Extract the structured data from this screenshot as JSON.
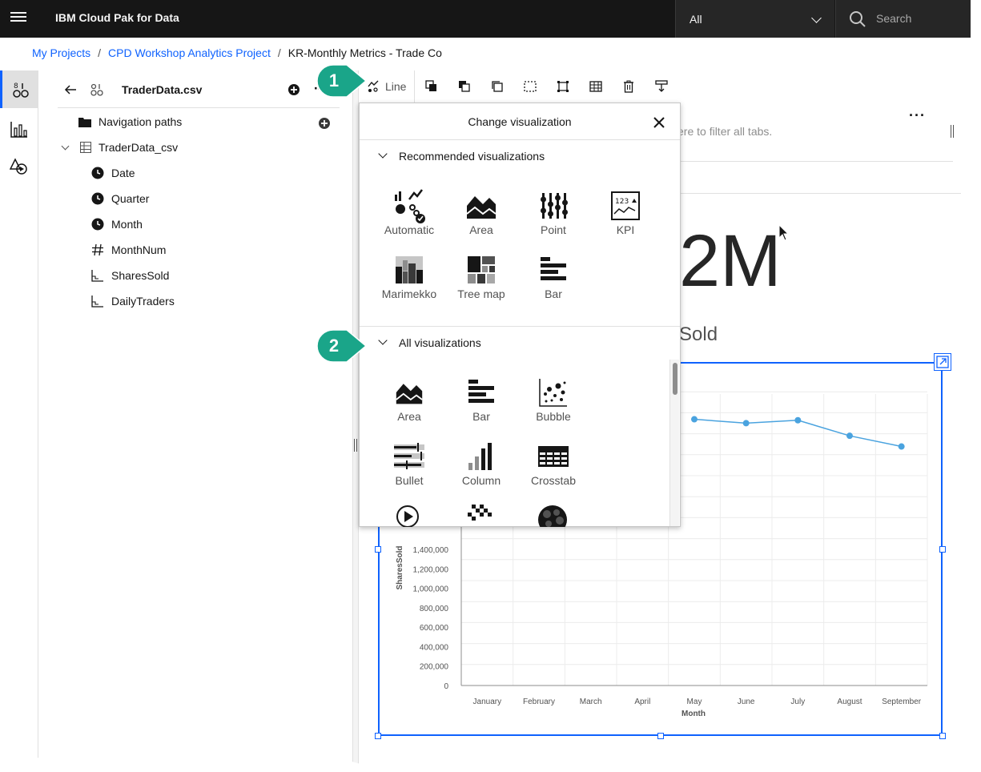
{
  "header": {
    "app_title": "IBM Cloud Pak for Data",
    "scope_value": "All",
    "search_placeholder": "Search"
  },
  "breadcrumb": {
    "items": [
      {
        "label": "My Projects"
      },
      {
        "label": "CPD Workshop Analytics Project"
      },
      {
        "label": "KR-Monthly Metrics - Trade Co"
      }
    ],
    "separator": "/"
  },
  "data_panel": {
    "title": "TraderData.csv",
    "navigation_paths": "Navigation paths",
    "table_name": "TraderData_csv",
    "columns": [
      {
        "label": "Date",
        "icon": "clock-icon"
      },
      {
        "label": "Quarter",
        "icon": "clock-icon"
      },
      {
        "label": "Month",
        "icon": "clock-icon"
      },
      {
        "label": "MonthNum",
        "icon": "hash-icon"
      },
      {
        "label": "SharesSold",
        "icon": "measure-icon"
      },
      {
        "label": "DailyTraders",
        "icon": "measure-icon"
      }
    ]
  },
  "toolbar": {
    "viz_label": "Line"
  },
  "filter_strip": {
    "hint": "ere to filter all tabs."
  },
  "kpi": {
    "value": "2M",
    "caption": "Sold"
  },
  "popover": {
    "title": "Change visualization",
    "recommended_label": "Recommended visualizations",
    "all_label": "All visualizations",
    "recommended": [
      {
        "label": "Automatic"
      },
      {
        "label": "Area"
      },
      {
        "label": "Point"
      },
      {
        "label": "KPI"
      },
      {
        "label": "Marimekko"
      },
      {
        "label": "Tree map"
      },
      {
        "label": "Bar"
      }
    ],
    "all": [
      {
        "label": "Area"
      },
      {
        "label": "Bar"
      },
      {
        "label": "Bubble"
      },
      {
        "label": "Bullet"
      },
      {
        "label": "Column"
      },
      {
        "label": "Crosstab"
      }
    ]
  },
  "callouts": [
    {
      "label": "1"
    },
    {
      "label": "2"
    }
  ],
  "colors": {
    "accent": "#0f62fe",
    "callout": "#1aa589",
    "series": "#4aa3df",
    "header_bg": "#161616"
  },
  "chart_data": {
    "type": "line",
    "xlabel": "Month",
    "ylabel": "SharesSold",
    "categories": [
      "January",
      "February",
      "March",
      "April",
      "May",
      "June",
      "July",
      "August",
      "September"
    ],
    "visible_points": [
      {
        "x": "May",
        "y": 2740000
      },
      {
        "x": "June",
        "y": 2700000
      },
      {
        "x": "July",
        "y": 2730000
      },
      {
        "x": "August",
        "y": 2570000
      },
      {
        "x": "September",
        "y": 2460000
      }
    ],
    "y_ticks": [
      "0",
      "200,000",
      "400,000",
      "600,000",
      "800,000",
      "1,000,000",
      "1,200,000",
      "1,400,000"
    ],
    "ylim": [
      0,
      3000000
    ],
    "grid": true
  }
}
